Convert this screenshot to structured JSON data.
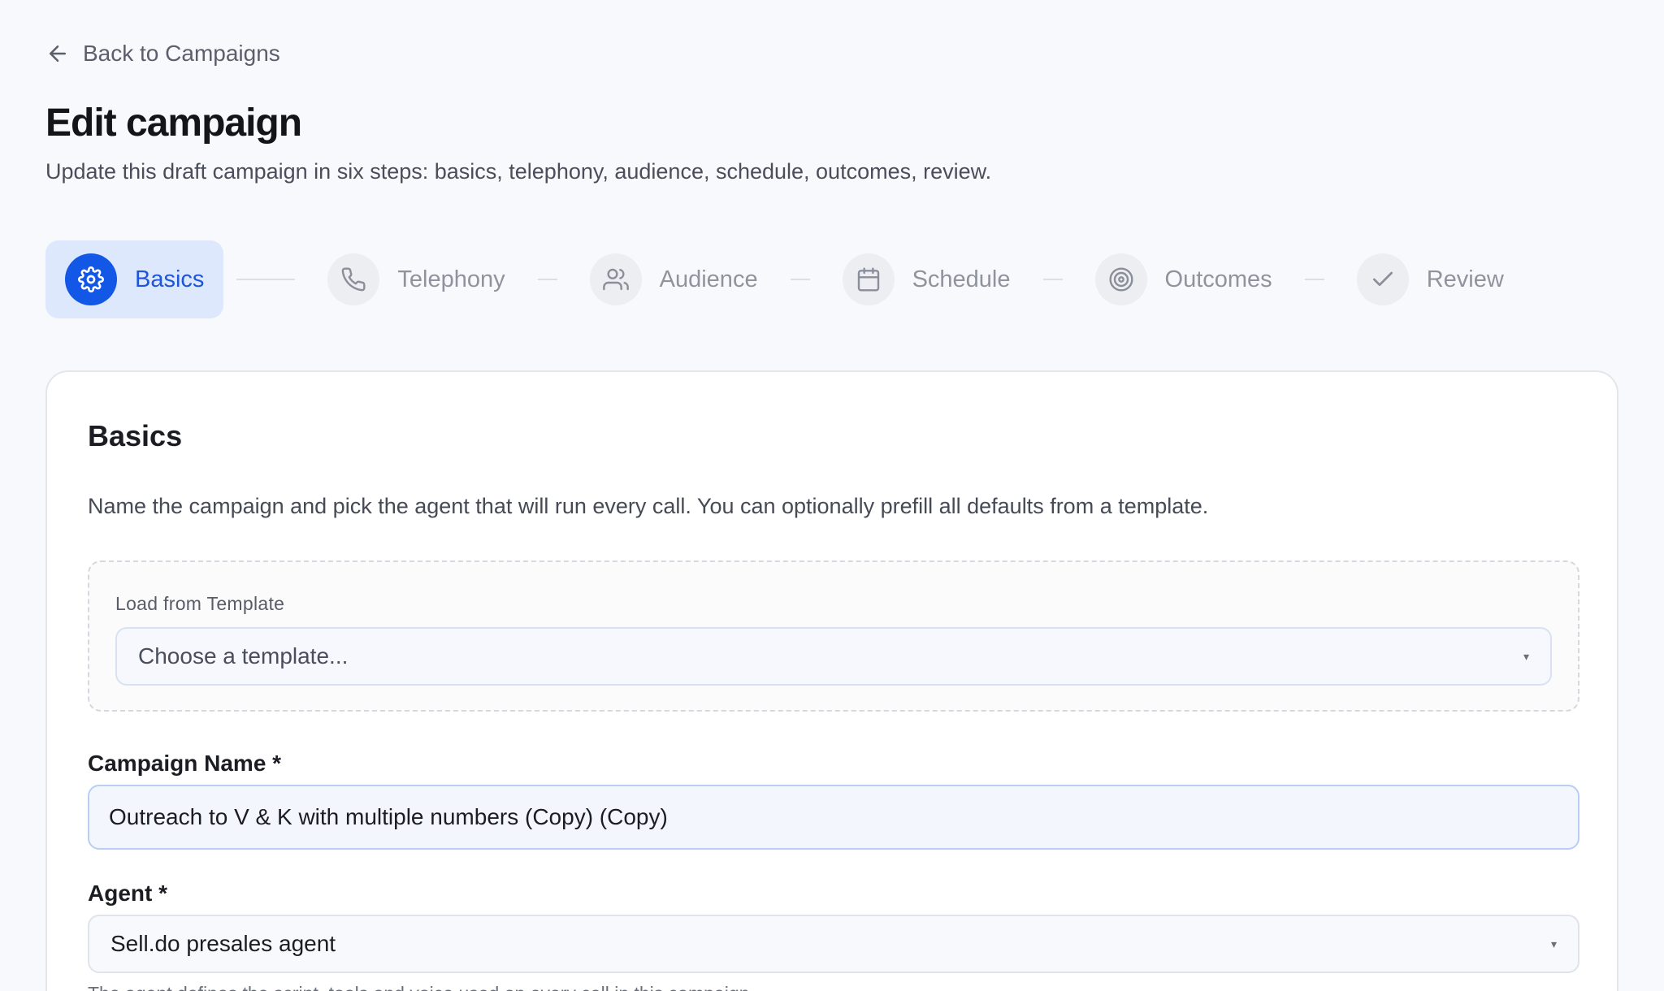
{
  "nav": {
    "back_label": "Back to Campaigns"
  },
  "header": {
    "title": "Edit campaign",
    "subtitle": "Update this draft campaign in six steps: basics, telephony, audience, schedule, outcomes, review."
  },
  "steps": [
    {
      "label": "Basics",
      "icon": "gear-icon",
      "active": true
    },
    {
      "label": "Telephony",
      "icon": "phone-icon",
      "active": false
    },
    {
      "label": "Audience",
      "icon": "users-icon",
      "active": false
    },
    {
      "label": "Schedule",
      "icon": "calendar-icon",
      "active": false
    },
    {
      "label": "Outcomes",
      "icon": "target-icon",
      "active": false
    },
    {
      "label": "Review",
      "icon": "check-icon",
      "active": false
    }
  ],
  "card": {
    "title": "Basics",
    "description": "Name the campaign and pick the agent that will run every call. You can optionally prefill all defaults from a template.",
    "template": {
      "label": "Load from Template",
      "placeholder": "Choose a template...",
      "caret": "▾"
    },
    "campaign_name": {
      "label": "Campaign Name *",
      "value": "Outreach to V & K with multiple numbers (Copy) (Copy)"
    },
    "agent": {
      "label": "Agent *",
      "value": "Sell.do presales agent",
      "caret": "▾",
      "helper": "The agent defines the script, tools and voice used on every call in this campaign."
    }
  },
  "colors": {
    "accent": "#1357e6",
    "active_step_bg": "#dde8fc",
    "page_bg": "#f8f9fc"
  }
}
